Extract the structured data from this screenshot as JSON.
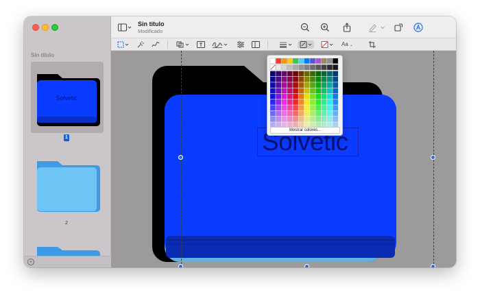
{
  "window": {
    "doc_title": "Sin título",
    "doc_subtitle": "Modificado"
  },
  "sidebar": {
    "heading": "Sin título",
    "pages": [
      {
        "number": "1",
        "label": "Solvetic",
        "selected": true,
        "folder_color": "#0a3cff"
      },
      {
        "number": "2",
        "label": "",
        "selected": false,
        "folder_color": "#6ec4f5"
      }
    ]
  },
  "toolbar": {
    "icons": [
      "sidebar-toggle-icon",
      "zoom-out-icon",
      "zoom-in-icon",
      "share-icon",
      "highlight-pen-icon",
      "rotate-icon",
      "markup-icon"
    ]
  },
  "markup_bar": {
    "icons": [
      "rect-select-icon",
      "magic-select-icon",
      "sketch-icon",
      "shapes-icon",
      "text-box-icon",
      "signature-icon",
      "adjust-color-icon",
      "page-layout-icon",
      "line-style-icon",
      "border-color-icon",
      "fill-color-icon",
      "text-style-icon",
      "crop-icon"
    ],
    "text_style_label": "Aa"
  },
  "canvas": {
    "folder_color": "#0a3cff",
    "text": "Solvetic"
  },
  "color_palette": {
    "show_colors_label": "Mostrar colores...",
    "top_row": [
      "#ffffff",
      "#ff3b30",
      "#ff9500",
      "#ffcc00",
      "#34c759",
      "#5ac8fa",
      "#007aff",
      "#5856d6",
      "#af52de",
      "#a2845e",
      "#8e8e93",
      "#000000"
    ]
  }
}
